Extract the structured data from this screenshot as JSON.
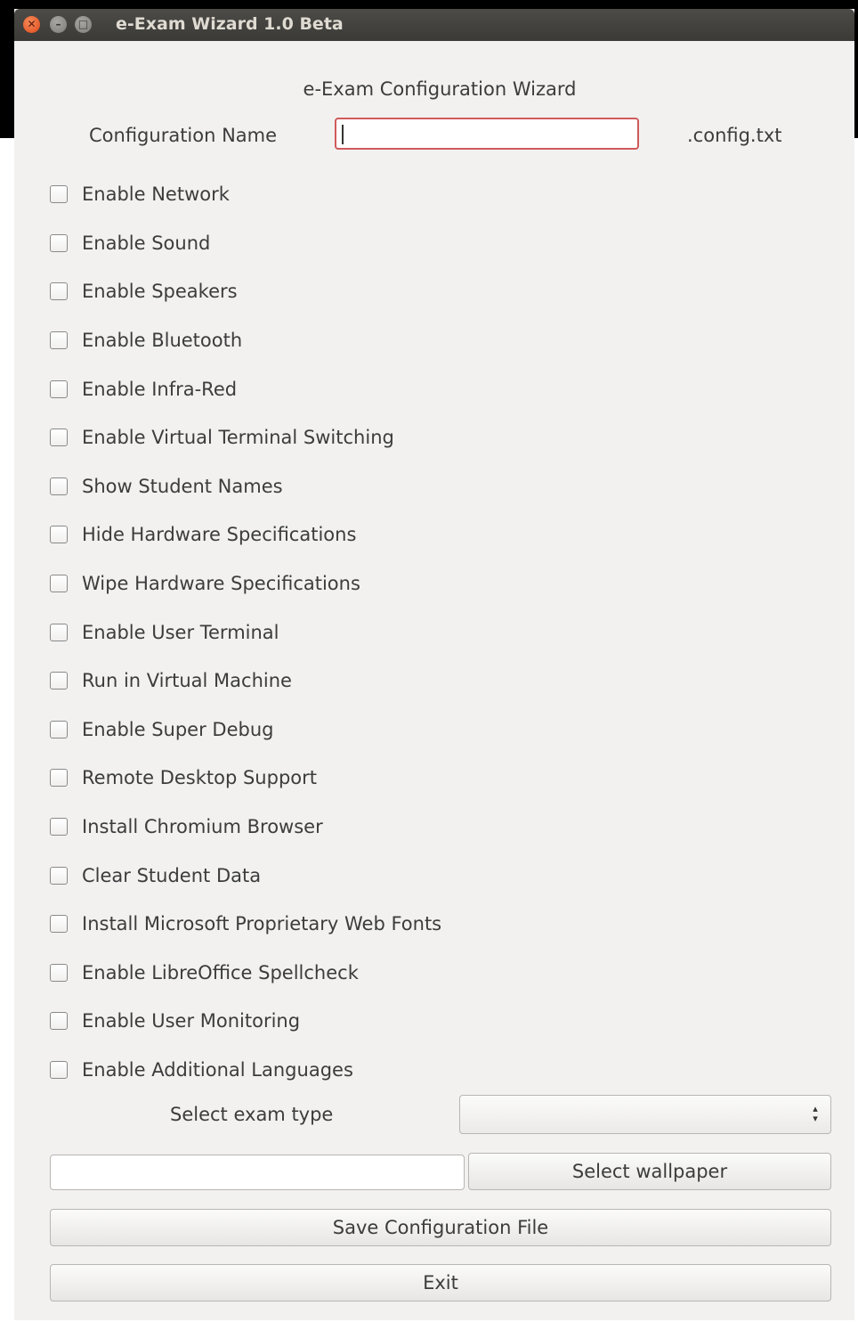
{
  "window": {
    "title": "e-Exam Wizard 1.0 Beta",
    "close_glyph": "✕",
    "minimize_glyph": "–",
    "maximize_glyph": "□"
  },
  "heading": "e-Exam Configuration Wizard",
  "config": {
    "label": "Configuration Name",
    "value": "",
    "suffix": ".config.txt"
  },
  "options": [
    {
      "label": "Enable Network",
      "checked": false
    },
    {
      "label": "Enable Sound",
      "checked": false
    },
    {
      "label": "Enable Speakers",
      "checked": false
    },
    {
      "label": "Enable Bluetooth",
      "checked": false
    },
    {
      "label": "Enable Infra-Red",
      "checked": false
    },
    {
      "label": "Enable Virtual Terminal Switching",
      "checked": false
    },
    {
      "label": "Show Student Names",
      "checked": false
    },
    {
      "label": "Hide Hardware Specifications",
      "checked": false
    },
    {
      "label": "Wipe Hardware Specifications",
      "checked": false
    },
    {
      "label": "Enable User Terminal",
      "checked": false
    },
    {
      "label": "Run in Virtual Machine",
      "checked": false
    },
    {
      "label": "Enable Super Debug",
      "checked": false
    },
    {
      "label": "Remote Desktop Support",
      "checked": false
    },
    {
      "label": "Install Chromium Browser",
      "checked": false
    },
    {
      "label": "Clear Student Data",
      "checked": false
    },
    {
      "label": "Install Microsoft Proprietary Web Fonts",
      "checked": false
    },
    {
      "label": "Enable LibreOffice Spellcheck",
      "checked": false
    },
    {
      "label": "Enable User Monitoring",
      "checked": false
    },
    {
      "label": "Enable Additional Languages",
      "checked": false
    }
  ],
  "exam_type": {
    "label": "Select exam type",
    "value": "",
    "spin_glyph": "⬍"
  },
  "wallpaper": {
    "path_value": "",
    "button_label": "Select wallpaper"
  },
  "actions": {
    "save_label": "Save Configuration File",
    "exit_label": "Exit"
  },
  "colors": {
    "window_bg": "#f2f1f0",
    "titlebar": "#3b3a36",
    "close_button": "#e0491a",
    "focus_border": "#d05a5a"
  }
}
